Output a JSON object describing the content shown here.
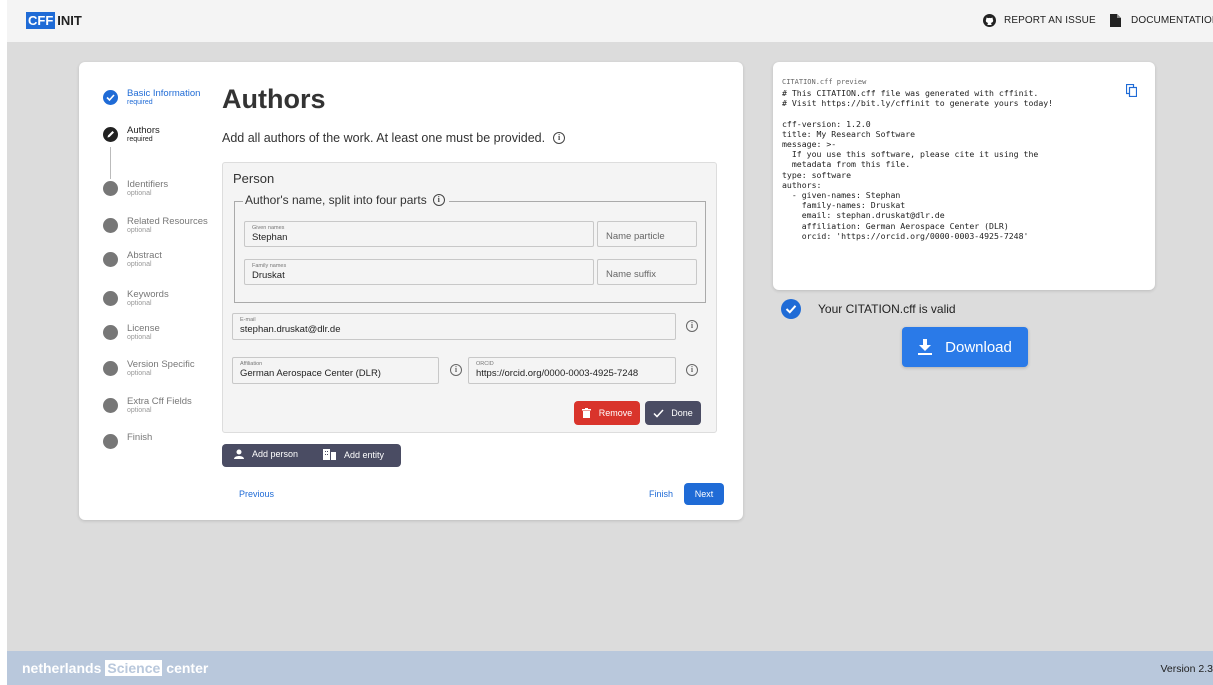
{
  "header": {
    "logo_cff": "CFF",
    "logo_init": "INIT",
    "report_issue": "REPORT AN ISSUE",
    "documentation": "DOCUMENTATION"
  },
  "stepper": {
    "steps": [
      {
        "title": "Basic Information",
        "sub": "required",
        "state": "done"
      },
      {
        "title": "Authors",
        "sub": "required",
        "state": "active"
      },
      {
        "title": "Identifiers",
        "sub": "optional",
        "state": "pending"
      },
      {
        "title": "Related Resources",
        "sub": "optional",
        "state": "pending"
      },
      {
        "title": "Abstract",
        "sub": "optional",
        "state": "pending"
      },
      {
        "title": "Keywords",
        "sub": "optional",
        "state": "pending"
      },
      {
        "title": "License",
        "sub": "optional",
        "state": "pending"
      },
      {
        "title": "Version Specific",
        "sub": "optional",
        "state": "pending"
      },
      {
        "title": "Extra Cff Fields",
        "sub": "optional",
        "state": "pending"
      },
      {
        "title": "Finish",
        "sub": "",
        "state": "pending"
      }
    ]
  },
  "main": {
    "title": "Authors",
    "intro": "Add all authors of the work. At least one must be provided.",
    "person": {
      "heading": "Person",
      "legend": "Author's name, split into four parts",
      "given_names_label": "Given names",
      "given_names_value": "Stephan",
      "name_particle_placeholder": "Name particle",
      "family_names_label": "Family names",
      "family_names_value": "Druskat",
      "name_suffix_placeholder": "Name suffix",
      "email_label": "E-mail",
      "email_value": "stephan.druskat@dlr.de",
      "affiliation_label": "Affiliation",
      "affiliation_value": "German Aerospace Center (DLR)",
      "orcid_label": "ORCID",
      "orcid_value": "https://orcid.org/0000-0003-4925-7248",
      "remove_label": "Remove",
      "done_label": "Done"
    },
    "add_person": "Add person",
    "add_entity": "Add entity",
    "previous": "Previous",
    "finish": "Finish",
    "next": "Next"
  },
  "preview": {
    "label": "CITATION.cff preview",
    "code": "# This CITATION.cff file was generated with cffinit.\n# Visit https://bit.ly/cffinit to generate yours today!\n\ncff-version: 1.2.0\ntitle: My Research Software\nmessage: >-\n  If you use this software, please cite it using the\n  metadata from this file.\ntype: software\nauthors:\n  - given-names: Stephan\n    family-names: Druskat\n    email: stephan.druskat@dlr.de\n    affiliation: German Aerospace Center (DLR)\n    orcid: 'https://orcid.org/0000-0003-4925-7248'"
  },
  "status": {
    "valid_text": "Your CITATION.cff is valid",
    "download": "Download"
  },
  "footer": {
    "brand_a": "netherlands",
    "brand_b": "Science",
    "brand_c": "center",
    "version": "Version 2.3"
  },
  "colors": {
    "accent": "#1f6bd6",
    "remove": "#d9342b",
    "dark_button": "#4a4c63",
    "footer": "#b9c8dc"
  }
}
